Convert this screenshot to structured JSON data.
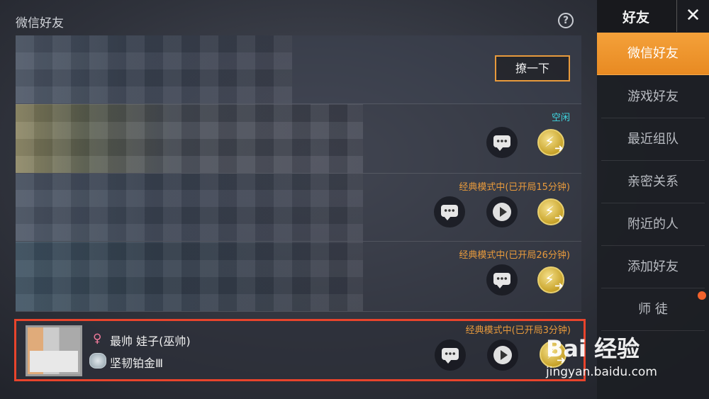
{
  "main": {
    "section_title": "微信好友",
    "help_icon": "?",
    "rows": [
      {
        "button_label": "撩一下"
      },
      {
        "status": "空闲"
      },
      {
        "status": "经典模式中(已开局15分钟)"
      },
      {
        "status": "经典模式中(已开局26分钟)"
      },
      {
        "status": "经典模式中(已开局3分钟)",
        "player_name": "最帅        娃子(巫帅)",
        "rank": "坚韧铂金Ⅲ"
      }
    ]
  },
  "sidebar": {
    "title": "好友",
    "close": "✕",
    "items": [
      {
        "label": "微信好友",
        "active": true
      },
      {
        "label": "游戏好友"
      },
      {
        "label": "最近组队"
      },
      {
        "label": "亲密关系"
      },
      {
        "label": "附近的人"
      },
      {
        "label": "添加好友"
      },
      {
        "label": "师 徒"
      }
    ]
  },
  "watermark": {
    "logo": "Bai 经验",
    "url": "jingyan.baidu.com"
  },
  "colors": {
    "accent": "#e89a3c",
    "idle": "#3fd6e0",
    "highlight_border": "#e8442c",
    "active_tab": "#f0962e"
  },
  "icons": [
    "help-icon",
    "chat-icon",
    "play-icon",
    "invite-icon",
    "close-icon",
    "female-icon",
    "rank-icon"
  ]
}
